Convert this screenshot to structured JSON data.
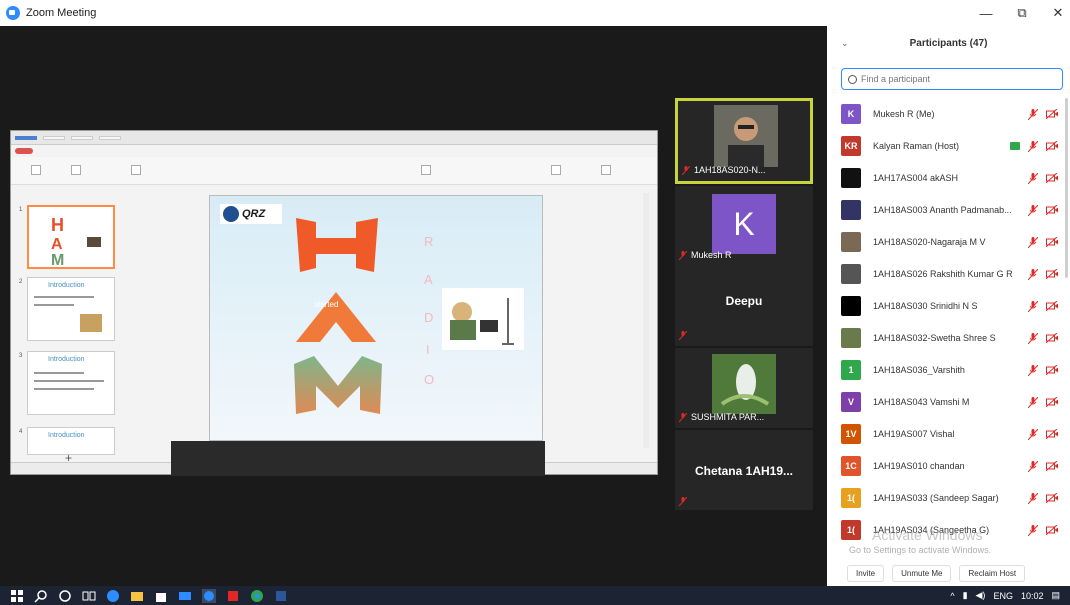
{
  "window": {
    "title": "Zoom Meeting",
    "minimize": "—",
    "restore": "⧉",
    "close": "✕"
  },
  "share": {
    "slide": {
      "logo_text": "QRZ",
      "ham_letters": [
        "H",
        "A",
        "M"
      ],
      "radio_letters": [
        "R",
        "A",
        "D",
        "I",
        "O"
      ],
      "overlay_text": "started"
    },
    "thumb_titles": [
      "Introduction",
      "Introduction",
      "Introduction"
    ]
  },
  "tiles": [
    {
      "name": "1AH18AS020-N...",
      "type": "video",
      "active": true
    },
    {
      "name": "Mukesh R",
      "type": "avatar",
      "avatar_letter": "K"
    },
    {
      "name": "Deepu",
      "type": "name-only"
    },
    {
      "name": "SUSHMITA PAR...",
      "type": "video"
    },
    {
      "name": "Chetana  1AH19...",
      "type": "name-only"
    }
  ],
  "participants_panel": {
    "title": "Participants (47)",
    "collapse_icon": "chevron-down-icon",
    "search_placeholder": "Find a participant",
    "participants": [
      {
        "initials": "K",
        "name": "Mukesh R (Me)",
        "color": "#7d55c7",
        "sharing": false
      },
      {
        "initials": "KR",
        "name": "Kalyan Raman (Host)",
        "color": "#c0392b",
        "sharing": true
      },
      {
        "initials": "",
        "name": "1AH17AS004 akASH",
        "color": "#111111",
        "sharing": false
      },
      {
        "initials": "",
        "name": "1AH18AS003 Ananth Padmanab...",
        "color": "#333366",
        "sharing": false
      },
      {
        "initials": "",
        "name": "1AH18AS020-Nagaraja M V",
        "color": "#7a6a55",
        "sharing": false
      },
      {
        "initials": "",
        "name": "1AH18AS026 Rakshith Kumar G R",
        "color": "#555555",
        "sharing": false
      },
      {
        "initials": "",
        "name": "1AH18AS030 Srinidhi N S",
        "color": "#000000",
        "sharing": false
      },
      {
        "initials": "",
        "name": "1AH18AS032-Swetha Shree S",
        "color": "#6a7a4a",
        "sharing": false
      },
      {
        "initials": "1",
        "name": "1AH18AS036_Varshith",
        "color": "#2fa74b",
        "sharing": false
      },
      {
        "initials": "V",
        "name": "1AH18AS043 Vamshi M",
        "color": "#7d3fa8",
        "sharing": false
      },
      {
        "initials": "1V",
        "name": "1AH19AS007 Vishal",
        "color": "#d35400",
        "sharing": false
      },
      {
        "initials": "1C",
        "name": "1AH19AS010 chandan",
        "color": "#e0532b",
        "sharing": false
      },
      {
        "initials": "1(",
        "name": "1AH19AS033 (Sandeep Sagar)",
        "color": "#e8a020",
        "sharing": false
      },
      {
        "initials": "1(",
        "name": "1AH19AS034 (Sangeetha G)",
        "color": "#c0392b",
        "sharing": false
      }
    ],
    "buttons": {
      "invite": "Invite",
      "unmute": "Unmute Me",
      "reclaim": "Reclaim Host"
    }
  },
  "watermark": {
    "line1": "Activate Windows",
    "line2": "Go to Settings to activate Windows."
  },
  "taskbar": {
    "lang": "ENG",
    "time": "10:02"
  },
  "colors": {
    "accent": "#2d8cff",
    "active_tile_border": "#c9d33a",
    "mic_muted": "#e02828"
  }
}
